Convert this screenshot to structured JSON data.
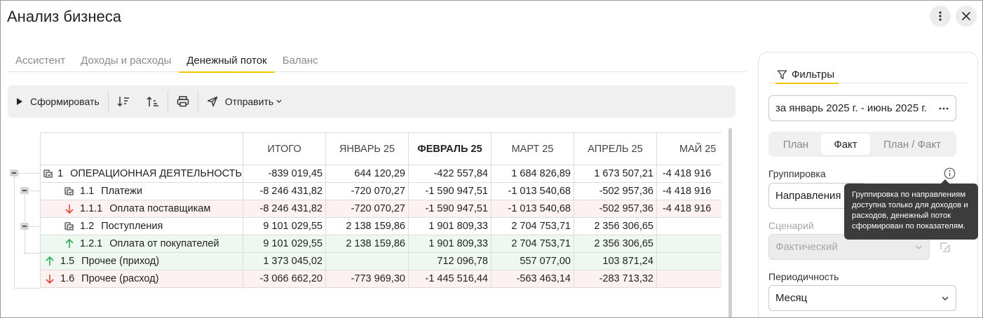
{
  "window": {
    "title": "Анализ бизнеса"
  },
  "tabs": [
    {
      "label": "Ассистент",
      "active": false
    },
    {
      "label": "Доходы и расходы",
      "active": false
    },
    {
      "label": "Денежный поток",
      "active": true
    },
    {
      "label": "Баланс",
      "active": false
    }
  ],
  "toolbar": {
    "generate_label": "Сформировать",
    "send_label": "Отправить"
  },
  "table": {
    "columns": [
      "ИТОГО",
      "ЯНВАРЬ 25",
      "ФЕВРАЛЬ 25",
      "МАРТ 25",
      "АПРЕЛЬ 25",
      "МАЙ 25"
    ],
    "rows": [
      {
        "code": "1",
        "name": "ОПЕРАЦИОННАЯ ДЕЯТЕЛЬНОСТЬ",
        "icon": "group-icon",
        "cells": [
          "-839 019,45",
          "644 120,29",
          "-422 557,84",
          "1 684 826,89",
          "1 673 507,21",
          "-4 418 916"
        ]
      },
      {
        "code": "1.1",
        "name": "Платежи",
        "icon": "group-icon",
        "cells": [
          "-8 246 431,82",
          "-720 070,27",
          "-1 590 947,51",
          "-1 013 540,68",
          "-502 957,36",
          "-4 418 916"
        ]
      },
      {
        "code": "1.1.1",
        "name": "Оплата поставщикам",
        "icon": "arrow-down-icon",
        "cells": [
          "-8 246 431,82",
          "-720 070,27",
          "-1 590 947,51",
          "-1 013 540,68",
          "-502 957,36",
          "-4 418 916"
        ]
      },
      {
        "code": "1.2",
        "name": "Поступления",
        "icon": "group-icon",
        "cells": [
          "9 101 029,55",
          "2 138 159,86",
          "1 901 809,33",
          "2 704 753,71",
          "2 356 306,65",
          ""
        ]
      },
      {
        "code": "1.2.1",
        "name": "Оплата от покупателей",
        "icon": "arrow-up-icon",
        "cells": [
          "9 101 029,55",
          "2 138 159,86",
          "1 901 809,33",
          "2 704 753,71",
          "2 356 306,65",
          ""
        ]
      },
      {
        "code": "1.5",
        "name": "Прочее (приход)",
        "icon": "arrow-up-icon",
        "cells": [
          "1 373 045,02",
          "",
          "712 096,78",
          "557 077,00",
          "103 871,24",
          ""
        ]
      },
      {
        "code": "1.6",
        "name": "Прочее (расход)",
        "icon": "arrow-down-icon",
        "cells": [
          "-3 066 662,20",
          "-773 969,30",
          "-1 445 516,44",
          "-563 463,14",
          "-283 713,32",
          ""
        ]
      }
    ]
  },
  "filters": {
    "tab_label": "Фильтры",
    "period_value": "за январь 2025 г. - июнь 2025 г.",
    "mode_options": [
      "План",
      "Факт",
      "План / Факт"
    ],
    "mode_selected": "Факт",
    "grouping_label": "Группировка",
    "grouping_value": "Направления",
    "scenario_label": "Сценарий",
    "scenario_value": "Фактический",
    "periodicity_label": "Периодичность",
    "periodicity_value": "Месяц",
    "tooltip": "Группировка по направлениям доступна только для доходов и расходов, денежный поток сформирован по показателям."
  },
  "colors": {
    "accent": "#f4c400",
    "negative_row": "#fdf1f1",
    "positive_row": "#eef8f0",
    "down_arrow": "#e0453a",
    "up_arrow": "#2eaa56"
  }
}
